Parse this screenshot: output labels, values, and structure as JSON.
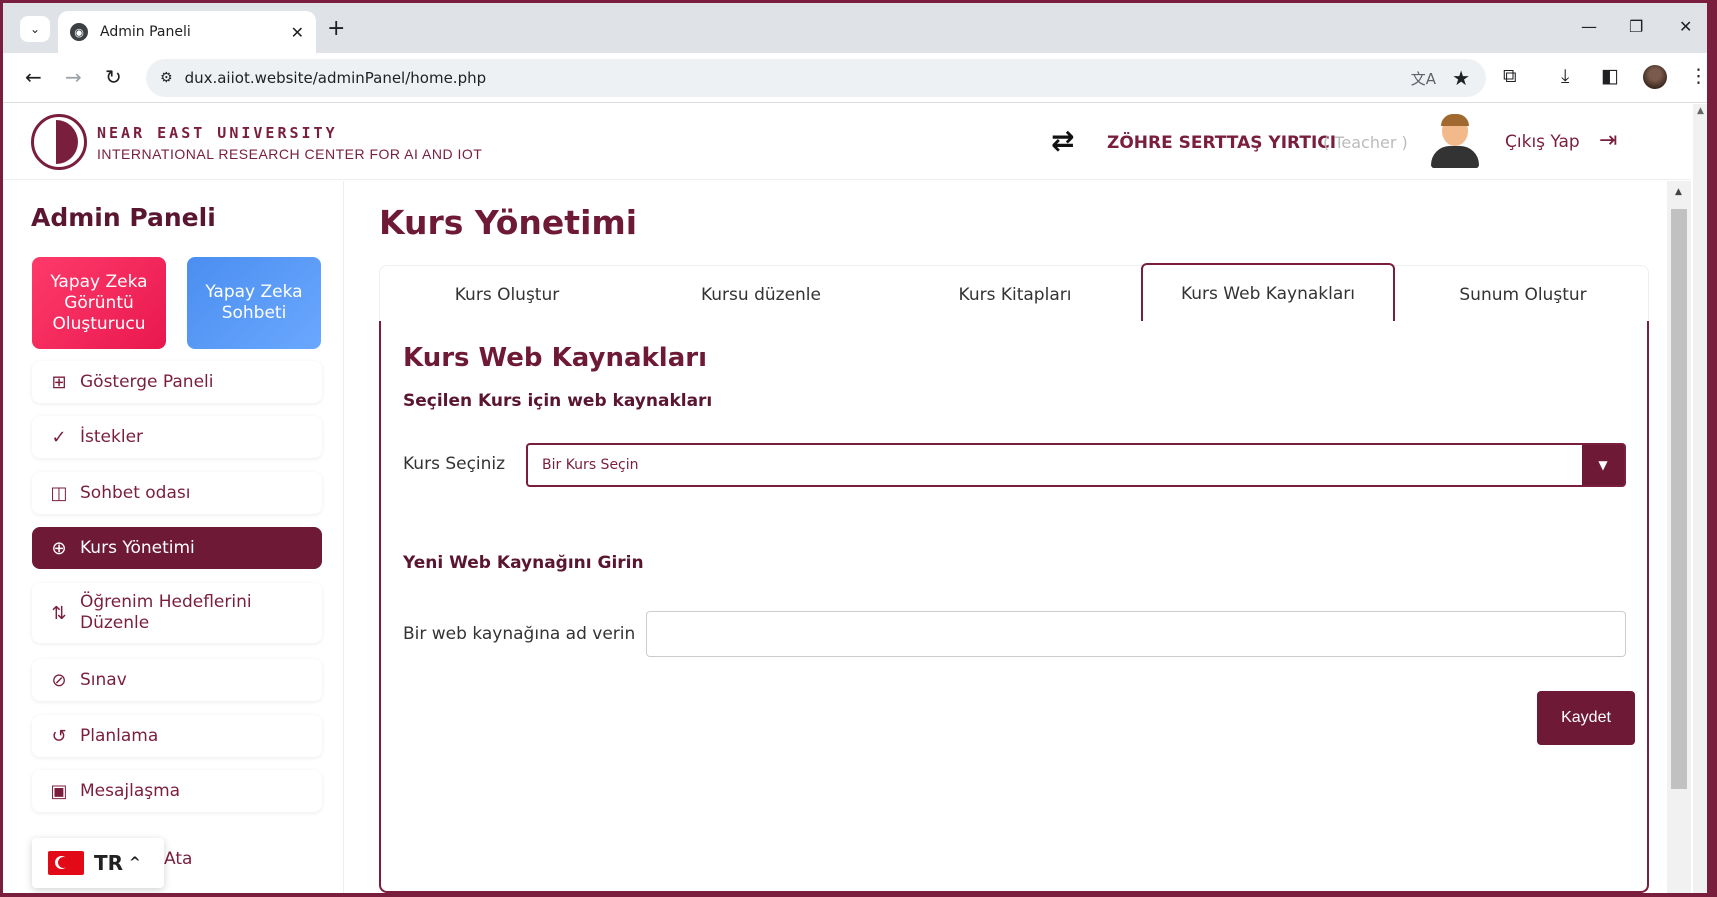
{
  "browser": {
    "tab_title": "Admin Paneli",
    "tab_close": "✕",
    "new_tab": "+",
    "url": "dux.aiiot.website/adminPanel/home.php",
    "window_controls": {
      "minimize": "—",
      "restore": "❐",
      "close": "✕"
    }
  },
  "header": {
    "logo_name": "NEAR EAST UNIVERSITY",
    "logo_subtitle": "INTERNATIONAL RESEARCH CENTER FOR AI AND IOT",
    "user_name": "ZÖHRE SERTTAŞ YIRTICI",
    "user_role": "( Teacher )",
    "logout_label": "Çıkış Yap"
  },
  "sidebar": {
    "title": "Admin Paneli",
    "tiles": [
      {
        "label": "Yapay Zeka Görüntü Oluşturucu",
        "color": "#f0245a"
      },
      {
        "label": "Yapay Zeka Sohbeti",
        "color": "#5a9cf6"
      }
    ],
    "items": [
      {
        "label": "Gösterge Paneli",
        "icon": "dashboard-icon"
      },
      {
        "label": "İstekler",
        "icon": "check-circle-icon"
      },
      {
        "label": "Sohbet odası",
        "icon": "chat-icon"
      },
      {
        "label": "Kurs Yönetimi",
        "icon": "grid-plus-icon",
        "active": true
      },
      {
        "label": "Öğrenim Hedeflerini Düzenle",
        "icon": "sort-icon"
      },
      {
        "label": "Sınav",
        "icon": "compass-icon"
      },
      {
        "label": "Planlama",
        "icon": "history-icon"
      },
      {
        "label": "Mesajlaşma",
        "icon": "message-icon"
      }
    ],
    "partial_item_label": "Ata",
    "language": {
      "code": "TR",
      "caret": "^"
    }
  },
  "main": {
    "page_title": "Kurs Yönetimi",
    "tabs": [
      {
        "label": "Kurs Oluştur"
      },
      {
        "label": "Kursu düzenle"
      },
      {
        "label": "Kurs Kitapları"
      },
      {
        "label": "Kurs Web Kaynakları",
        "active": true
      },
      {
        "label": "Sunum Oluştur"
      }
    ],
    "card": {
      "title": "Kurs Web Kaynakları",
      "section1": "Seçilen Kurs için web kaynakları",
      "select_label": "Kurs Seçiniz",
      "select_value": "Bir Kurs Seçin",
      "section2": "Yeni Web Kaynağını Girin",
      "name_label": "Bir web kaynağına ad verin",
      "name_value": "",
      "save_label": "Kaydet"
    }
  },
  "colors": {
    "brand": "#6e1a36",
    "accent_red": "#f0245a",
    "accent_blue": "#5a9cf6"
  }
}
